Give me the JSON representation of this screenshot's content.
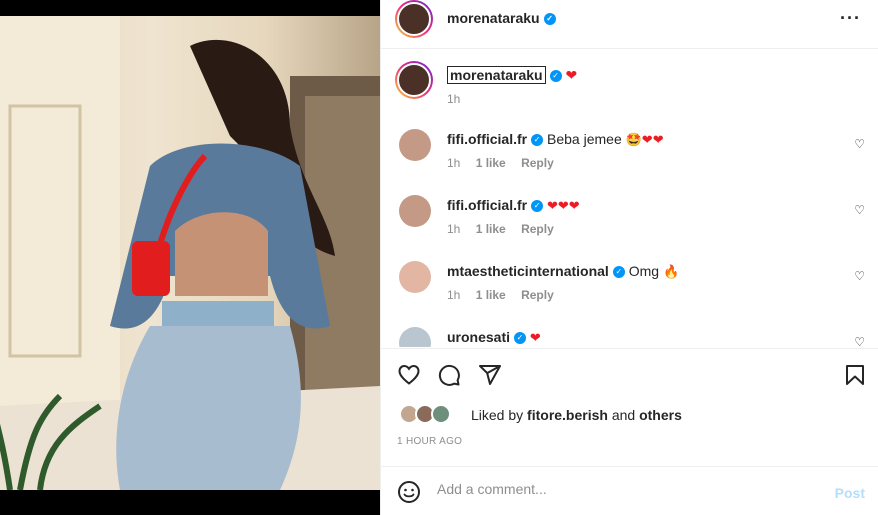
{
  "post": {
    "author": "morenataraku",
    "caption_heart": "❤"
  },
  "caption": {
    "username": "morenataraku",
    "time": "1h"
  },
  "comments": [
    {
      "username": "fifi.official.fr",
      "text": "Beba jemee",
      "emoji": "🤩❤❤",
      "time": "1h",
      "likes": "1 like",
      "reply": "Reply"
    },
    {
      "username": "fifi.official.fr",
      "text": "",
      "emoji": "❤❤❤",
      "time": "1h",
      "likes": "1 like",
      "reply": "Reply"
    },
    {
      "username": "mtaestheticinternational",
      "text": "Omg",
      "emoji": "🔥",
      "time": "1h",
      "likes": "1 like",
      "reply": "Reply"
    },
    {
      "username": "uronesati",
      "text": "",
      "emoji": "❤",
      "time": "",
      "likes": "",
      "reply": ""
    }
  ],
  "likes": {
    "prefix": "Liked by",
    "user": "fitore.berish",
    "and": "and",
    "others": "others"
  },
  "timestamp": "1 HOUR AGO",
  "composer": {
    "placeholder": "Add a comment...",
    "post_label": "Post"
  },
  "colors": {
    "verified": "#0095f6",
    "heart": "#ed1c24",
    "post_disabled": "#b2dffc"
  },
  "icons": [
    "heart-icon",
    "comment-icon",
    "share-icon",
    "bookmark-icon",
    "more-icon",
    "emoji-icon",
    "verified-icon"
  ]
}
